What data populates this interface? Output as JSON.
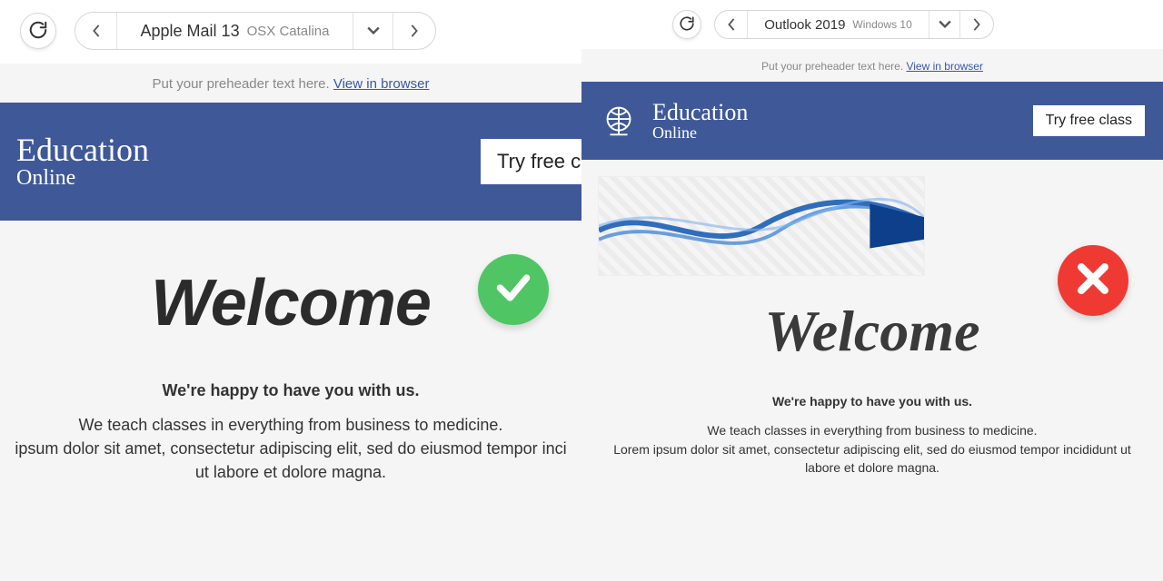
{
  "left": {
    "toolbar": {
      "client": "Apple Mail 13",
      "os": "OSX Catalina"
    },
    "preheader": {
      "text": "Put your preheader text here. ",
      "link": "View in browser"
    },
    "brand": {
      "line1": "Education",
      "line2": "Online"
    },
    "cta": "Try free cl",
    "welcome": "Welcome",
    "body": {
      "strong": "We're happy to have you with us.",
      "p1": "We teach classes in everything from business to medicine.",
      "p2": "ipsum dolor sit amet, consectetur adipiscing elit, sed do eiusmod tempor inci",
      "p3": "ut labore et dolore magna."
    },
    "status": "pass"
  },
  "right": {
    "toolbar": {
      "client": "Outlook 2019",
      "os": "Windows 10"
    },
    "preheader": {
      "text": "Put your preheader text here. ",
      "link": "View in browser"
    },
    "brand": {
      "line1": "Education",
      "line2": "Online"
    },
    "cta": "Try free class",
    "welcome": "Welcome",
    "body": {
      "strong": "We're happy to have you with us.",
      "p1": "We teach classes in everything from business to medicine.",
      "p2": "Lorem ipsum dolor sit amet, consectetur adipiscing elit, sed do eiusmod tempor incididunt ut",
      "p3": "labore et dolore magna."
    },
    "status": "fail"
  }
}
